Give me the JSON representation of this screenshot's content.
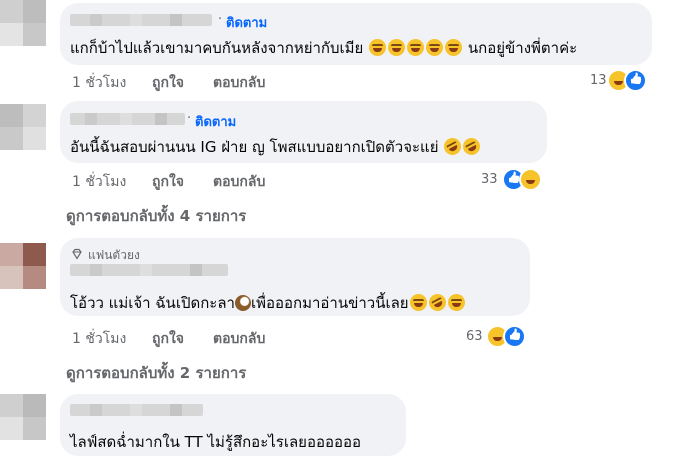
{
  "colors": {
    "bubble": "#f0f2f5",
    "link": "#0866ff",
    "meta": "#65676b",
    "text": "#050505",
    "like_blue": "#1877f2",
    "haha_yellow": "#f7c32b"
  },
  "comments": [
    {
      "follow_label": "ติดตาม",
      "text": "แกก็บ้าไปแล้วเขามาคบกันหลังจากหย่ากับเมีย",
      "emojis_inline": [
        "grinning-squinting",
        "grinning-squinting",
        "grinning-squinting",
        "grinning-squinting",
        "grinning-squinting"
      ],
      "text_after": "นกอยู่ข้างพี่ตาค่ะ",
      "time": "1 ชั่วโมง",
      "like": "ถูกใจ",
      "reply": "ตอบกลับ",
      "reaction_count": "13",
      "reactions": [
        "haha",
        "like"
      ]
    },
    {
      "follow_label": "ติดตาม",
      "text": "อันนี้ฉันสอบผ่านนน IG ฝ่าย ญ โพสแบบอยากเปิดตัวจะแย่",
      "emojis_inline": [
        "rofl",
        "rofl"
      ],
      "time": "1 ชั่วโมง",
      "like": "ถูกใจ",
      "reply": "ตอบกลับ",
      "reaction_count": "33",
      "reactions": [
        "like",
        "haha"
      ],
      "view_replies": "ดูการตอบกลับทั้ง 4 รายการ"
    },
    {
      "badge_label": "แฟนตัวยง",
      "text_before": "โอ้วว แม่เจ้า ฉันเปิดกะลา",
      "emoji_mid": "coconut",
      "text_after": "เพื่อออกมาอ่านข่าวนี้เลย",
      "emojis_inline": [
        "grinning-squinting",
        "rofl",
        "grinning-squinting"
      ],
      "time": "1 ชั่วโมง",
      "like": "ถูกใจ",
      "reply": "ตอบกลับ",
      "reaction_count": "63",
      "reactions": [
        "haha",
        "like"
      ],
      "view_replies": "ดูการตอบกลับทั้ง 2 รายการ"
    },
    {
      "text": "ไลฟ์สดฉ่ำมากใน TT ไม่รู้สึกอะไรเลยออออออ"
    }
  ]
}
